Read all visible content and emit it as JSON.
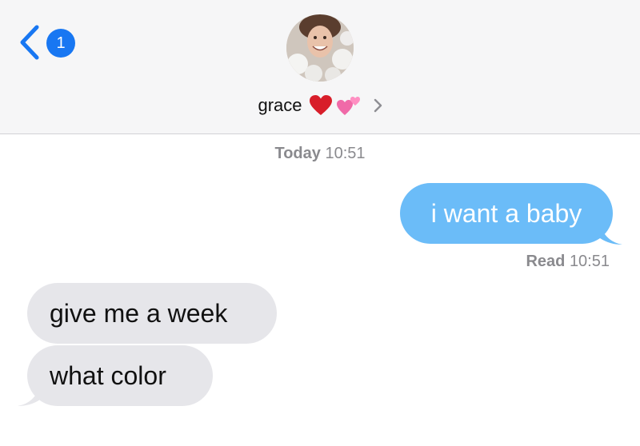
{
  "header": {
    "back_badge_count": "1",
    "contact_name": "grace",
    "contact_emoji_1": "❤️",
    "contact_emoji_2": "💕"
  },
  "timestamp": {
    "day": "Today",
    "time": "10:51"
  },
  "messages": [
    {
      "direction": "sent",
      "text": "i want a baby"
    },
    {
      "direction": "received",
      "text": "give me a week"
    },
    {
      "direction": "received",
      "text": "what color"
    }
  ],
  "receipt": {
    "label": "Read",
    "time": "10:51"
  },
  "colors": {
    "sent_bubble": "#6bbcf8",
    "received_bubble": "#e6e6ea",
    "accent": "#1877f2",
    "header_bg": "#f6f6f7",
    "meta_text": "#8a8a8e"
  },
  "icons": {
    "back": "chevron-left-icon",
    "disclosure": "chevron-right-icon"
  }
}
